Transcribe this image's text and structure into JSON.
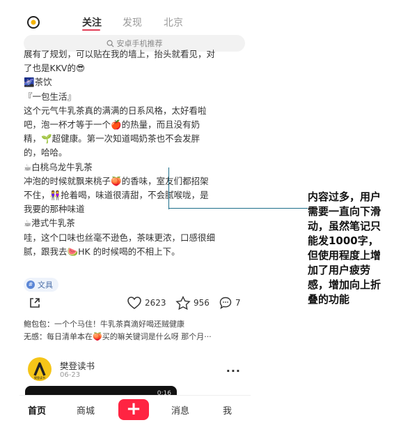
{
  "topnav": {
    "tabs": [
      "关注",
      "发现",
      "北京"
    ],
    "active_tab": "关注",
    "search_placeholder": "安卓手机推荐"
  },
  "note": {
    "cut_line": "展有了规划，可以贴在我的墙上，抬头就看见，对",
    "lines": [
      "了也是KKV的😎",
      "🌌茶饮",
      "『一包生活』",
      "这个元气牛乳茶真的满满的日系风格，太好看啦",
      "吧，泡一杯才等于一个🍎的热量，而且没有奶",
      "精，🌱超健康。第一次知道喝奶茶也不会发胖",
      "的，哈哈。",
      "☕白桃乌龙牛乳茶",
      "冲泡的时候就飘来桃子🍑的香味，室友们都招架",
      "不住，👭抢着喝，味道很清甜，不会腻喉咙，是",
      "我要的那种味道",
      "☕港式牛乳茶",
      "哇，这个口味也丝毫不逊色，茶味更浓，口感很细",
      "腻，跟我去🍉HK 的时候喝的不相上下。"
    ],
    "tag_label": "文具"
  },
  "actions": {
    "likes": "2623",
    "favorites": "956",
    "comments": "7"
  },
  "comments": [
    {
      "user": "鲍包包：",
      "text": "一个个马住！牛乳茶真滴好喝还贼健康"
    },
    {
      "user": "无感：",
      "text": "每日清单本在🍑买的嘛关键词是什么呀 那个月···"
    }
  ],
  "author": {
    "name": "樊登读书",
    "date": "06-23",
    "avatar_text": "樊登读书",
    "video_time": "0:16"
  },
  "bottomnav": {
    "home": "首页",
    "mall": "商城",
    "add": "+",
    "messages": "消息",
    "me": "我"
  },
  "annotation": {
    "text": "内容过多，用户需要一直向下滑动，虽然笔记只能发1000字，但使用程度上增加了用户疲劳感，增加向上折叠的功能"
  },
  "colors": {
    "accent": "#ff2442",
    "annotation_line": "#1c6e8a"
  }
}
